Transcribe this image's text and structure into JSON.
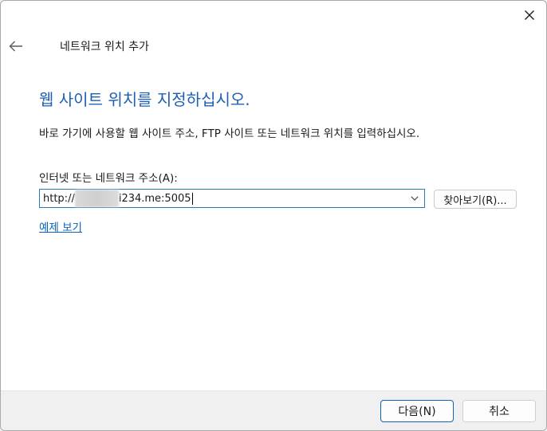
{
  "window": {
    "title": "네트워크 위치 추가"
  },
  "wizard": {
    "heading": "웹 사이트 위치를 지정하십시오.",
    "instruction": "바로 가기에 사용할 웹 사이트 주소, FTP 사이트 또는 네트워크 위치를 입력하십시오.",
    "address_label": "인터넷 또는 네트워크 주소(A):",
    "address_value_prefix": "http://",
    "address_value_suffix": "i234.me:5005",
    "browse_label": "찾아보기(R)...",
    "example_link": "예제 보기"
  },
  "footer": {
    "next_label": "다음(N)",
    "cancel_label": "취소"
  },
  "colors": {
    "heading": "#1f5fb4",
    "link": "#0b63b5",
    "focus_border": "#2a7ab8"
  },
  "icons": {
    "close": "close-icon",
    "back": "back-arrow-icon",
    "dropdown": "chevron-down-icon"
  }
}
